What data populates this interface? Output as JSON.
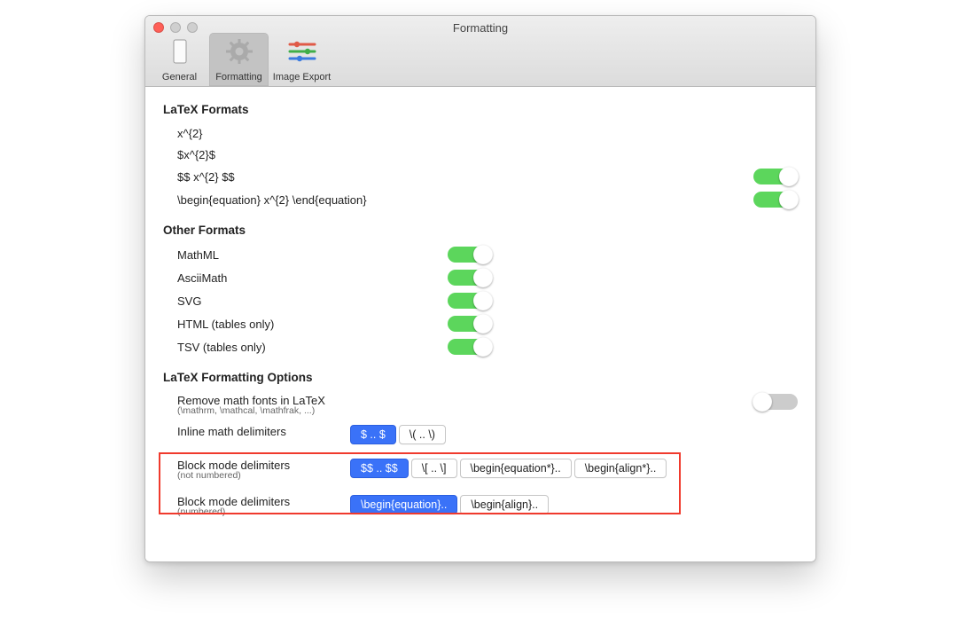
{
  "window": {
    "title": "Formatting"
  },
  "toolbar": {
    "items": [
      {
        "label": "General"
      },
      {
        "label": "Formatting"
      },
      {
        "label": "Image Export"
      }
    ]
  },
  "sections": {
    "latex_formats": {
      "title": "LaTeX Formats",
      "rows": [
        {
          "label": "x^{2}",
          "toggle": null
        },
        {
          "label": "$x^{2}$",
          "toggle": null
        },
        {
          "label": "$$ x^{2} $$",
          "toggle": true
        },
        {
          "label": "\\begin{equation} x^{2} \\end{equation}",
          "toggle": true
        }
      ]
    },
    "other_formats": {
      "title": "Other Formats",
      "rows": [
        {
          "label": "MathML",
          "toggle": true
        },
        {
          "label": "AsciiMath",
          "toggle": true
        },
        {
          "label": "SVG",
          "toggle": true
        },
        {
          "label": "HTML (tables only)",
          "toggle": true
        },
        {
          "label": "TSV (tables only)",
          "toggle": true
        }
      ]
    },
    "latex_options": {
      "title": "LaTeX Formatting Options",
      "remove_fonts": {
        "label": "Remove math fonts in LaTeX",
        "hint": "(\\mathrm, \\mathcal, \\mathfrak, ...)",
        "toggle": false
      },
      "inline": {
        "label": "Inline math delimiters",
        "options": [
          {
            "text": "$ .. $",
            "selected": true
          },
          {
            "text": "\\( .. \\)",
            "selected": false
          }
        ]
      },
      "block_unnumbered": {
        "label": "Block mode delimiters",
        "hint": "(not numbered)",
        "options": [
          {
            "text": "$$ .. $$",
            "selected": true
          },
          {
            "text": "\\[ .. \\]",
            "selected": false
          },
          {
            "text": "\\begin{equation*}..",
            "selected": false
          },
          {
            "text": "\\begin{align*}..",
            "selected": false
          }
        ]
      },
      "block_numbered": {
        "label": "Block mode delimiters",
        "hint": "(numbered)",
        "options": [
          {
            "text": "\\begin{equation}..",
            "selected": true
          },
          {
            "text": "\\begin{align}..",
            "selected": false
          }
        ]
      }
    }
  }
}
